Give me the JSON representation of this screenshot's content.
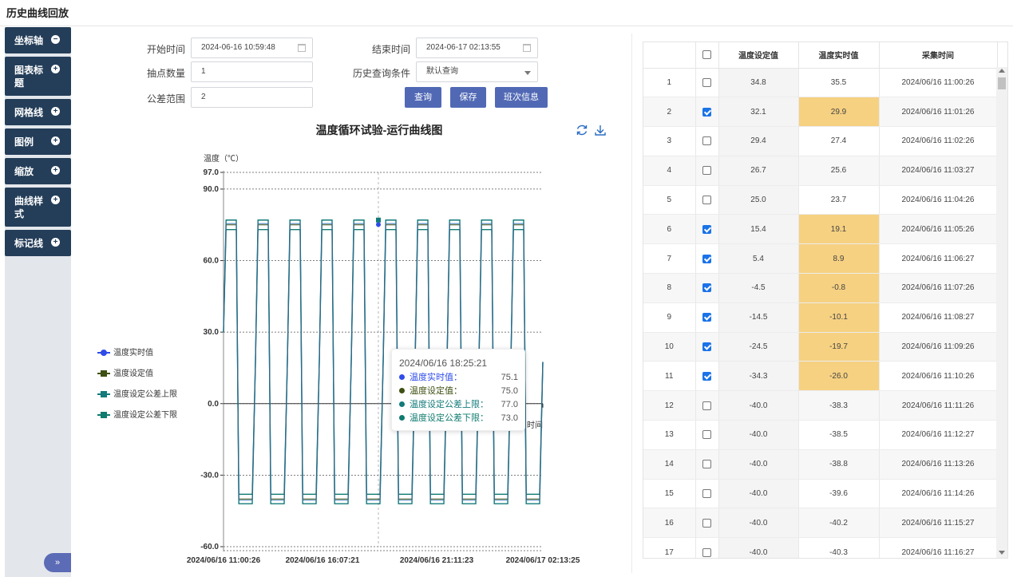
{
  "page": {
    "title": "历史曲线回放"
  },
  "sidebar": {
    "items": [
      {
        "label": "坐标轴"
      },
      {
        "label": "图表标题"
      },
      {
        "label": "网格线"
      },
      {
        "label": "图例"
      },
      {
        "label": "缩放"
      },
      {
        "label": "曲线样式"
      },
      {
        "label": "标记线"
      }
    ],
    "expand_icon": "»"
  },
  "form": {
    "start_label": "开始时间",
    "start_value": "2024-06-16 10:59:48",
    "end_label": "结束时间",
    "end_value": "2024-06-17 02:13:55",
    "points_label": "抽点数量",
    "points_value": "1",
    "condition_label": "历史查询条件",
    "condition_value": "默认查询",
    "tolerance_label": "公差范围",
    "tolerance_value": "2",
    "query_btn": "查询",
    "save_btn": "保存",
    "shift_btn": "班次信息"
  },
  "colors": {
    "realtime": "#2f4ce8",
    "setpoint": "#3e5012",
    "upper": "#127a7a",
    "lower": "#0f7b70",
    "highlight": "#f6d181",
    "nav": "#243e59"
  },
  "chart_data": {
    "type": "line",
    "title": "温度循环试验-运行曲线图",
    "ylabel": "温度（℃）",
    "xlabel": "时间",
    "ylim": [
      -60,
      97
    ],
    "yticks": [
      "97.0",
      "90.0",
      "60.0",
      "30.0",
      "0.0",
      "-30.0",
      "-60.0"
    ],
    "xticks": [
      "2024/06/16 11:00:26",
      "2024/06/16 16:07:21",
      "2024/06/16 21:11:23",
      "2024/06/17 02:13:25"
    ],
    "cycles": 10,
    "high_setpoint": 75.0,
    "low_setpoint": -40.0,
    "tolerance": 2,
    "series": [
      {
        "name": "温度实时值"
      },
      {
        "name": "温度设定值"
      },
      {
        "name": "温度设定公差上限"
      },
      {
        "name": "温度设定公差下限"
      }
    ],
    "legend_position": "left",
    "grid": true
  },
  "tooltip": {
    "time": "2024/06/16 18:25:21",
    "rows": [
      {
        "name": "温度实时值：",
        "value": "75.1"
      },
      {
        "name": "温度设定值：",
        "value": "75.0"
      },
      {
        "name": "温度设定公差上限：",
        "value": "77.0"
      },
      {
        "name": "温度设定公差下限：",
        "value": "73.0"
      }
    ]
  },
  "table": {
    "headers": [
      "",
      "温度设定值",
      "温度实时值",
      "采集时间"
    ],
    "rows": [
      {
        "no": "1",
        "checked": false,
        "set": "34.8",
        "real": "35.5",
        "time": "2024/06/16 11:00:26"
      },
      {
        "no": "2",
        "checked": true,
        "set": "32.1",
        "real": "29.9",
        "time": "2024/06/16 11:01:26"
      },
      {
        "no": "3",
        "checked": false,
        "set": "29.4",
        "real": "27.4",
        "time": "2024/06/16 11:02:26"
      },
      {
        "no": "4",
        "checked": false,
        "set": "26.7",
        "real": "25.6",
        "time": "2024/06/16 11:03:27"
      },
      {
        "no": "5",
        "checked": false,
        "set": "25.0",
        "real": "23.7",
        "time": "2024/06/16 11:04:26"
      },
      {
        "no": "6",
        "checked": true,
        "set": "15.4",
        "real": "19.1",
        "time": "2024/06/16 11:05:26"
      },
      {
        "no": "7",
        "checked": true,
        "set": "5.4",
        "real": "8.9",
        "time": "2024/06/16 11:06:27"
      },
      {
        "no": "8",
        "checked": true,
        "set": "-4.5",
        "real": "-0.8",
        "time": "2024/06/16 11:07:26"
      },
      {
        "no": "9",
        "checked": true,
        "set": "-14.5",
        "real": "-10.1",
        "time": "2024/06/16 11:08:27"
      },
      {
        "no": "10",
        "checked": true,
        "set": "-24.5",
        "real": "-19.7",
        "time": "2024/06/16 11:09:26"
      },
      {
        "no": "11",
        "checked": true,
        "set": "-34.3",
        "real": "-26.0",
        "time": "2024/06/16 11:10:26"
      },
      {
        "no": "12",
        "checked": false,
        "set": "-40.0",
        "real": "-38.3",
        "time": "2024/06/16 11:11:26"
      },
      {
        "no": "13",
        "checked": false,
        "set": "-40.0",
        "real": "-38.5",
        "time": "2024/06/16 11:12:27"
      },
      {
        "no": "14",
        "checked": false,
        "set": "-40.0",
        "real": "-38.8",
        "time": "2024/06/16 11:13:26"
      },
      {
        "no": "15",
        "checked": false,
        "set": "-40.0",
        "real": "-39.6",
        "time": "2024/06/16 11:14:26"
      },
      {
        "no": "16",
        "checked": false,
        "set": "-40.0",
        "real": "-40.2",
        "time": "2024/06/16 11:15:27"
      },
      {
        "no": "17",
        "checked": false,
        "set": "-40.0",
        "real": "-40.3",
        "time": "2024/06/16 11:16:27"
      }
    ]
  }
}
